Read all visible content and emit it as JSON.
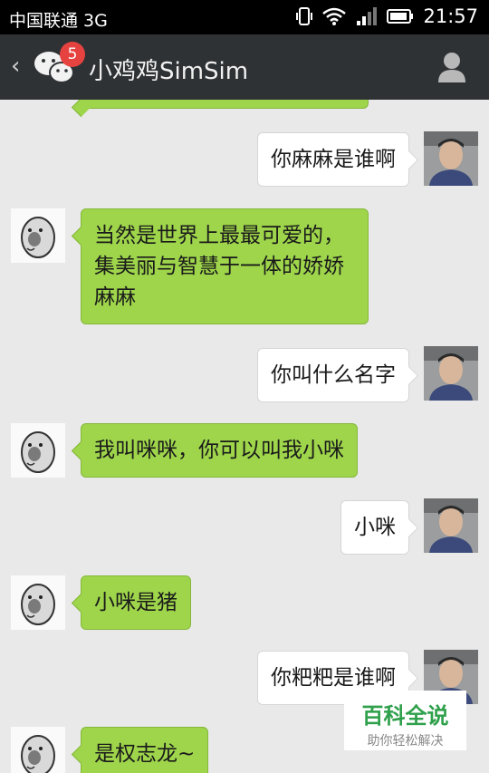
{
  "status_bar": {
    "carrier": "中国联通 3G",
    "time": "21:57"
  },
  "header": {
    "back_icon": "chevron-left",
    "unread_badge": "5",
    "title": "小鸡鸡SimSim",
    "profile_icon": "person-icon"
  },
  "messages": [
    {
      "sender": "me",
      "text": "你麻麻是谁啊"
    },
    {
      "sender": "bot",
      "text": "当然是世界上最最可爱的，集美丽与智慧于一体的娇娇麻麻"
    },
    {
      "sender": "me",
      "text": "你叫什么名字"
    },
    {
      "sender": "bot",
      "text": "我叫咪咪，你可以叫我小咪"
    },
    {
      "sender": "me",
      "text": "小咪"
    },
    {
      "sender": "bot",
      "text": "小咪是猪"
    },
    {
      "sender": "me",
      "text": "你粑粑是谁啊"
    },
    {
      "sender": "bot",
      "text": "是权志龙~"
    }
  ],
  "watermark": {
    "title": "百科全说",
    "subtitle": "助你轻松解决"
  },
  "colors": {
    "incoming_bubble": "#9ed54b",
    "outgoing_bubble": "#ffffff",
    "title_bar": "#2f3235",
    "background": "#e9e9e9",
    "badge": "#e64340"
  }
}
